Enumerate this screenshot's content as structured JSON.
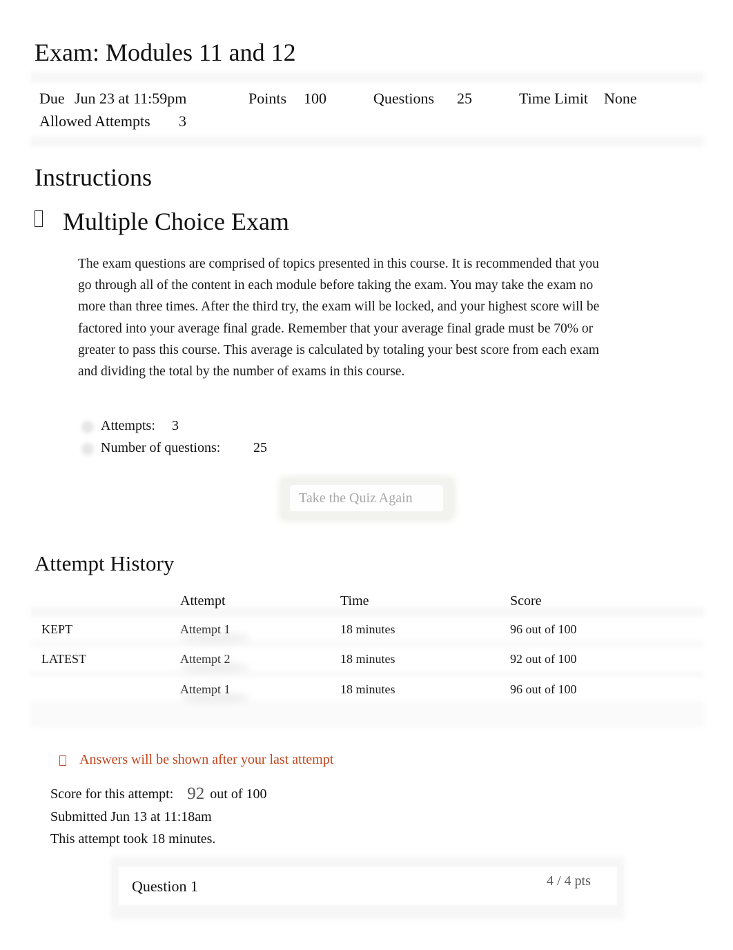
{
  "page": {
    "title": "Exam: Modules 11 and 12"
  },
  "meta": {
    "due_label": "Due",
    "due_value": "Jun 23 at 11:59pm",
    "points_label": "Points",
    "points_value": "100",
    "questions_label": "Questions",
    "questions_value": "25",
    "time_limit_label": "Time Limit",
    "time_limit_value": "None",
    "allowed_attempts_label": "Allowed Attempts",
    "allowed_attempts_value": "3"
  },
  "instructions": {
    "heading": "Instructions",
    "icon": "document-icon",
    "icon_glyph": "▯",
    "subheading": "Multiple Choice Exam",
    "paragraph": "The exam questions are comprised of topics presented in this course. It is recommended that you go through all of the content in each module before taking the exam. You may take the exam no more than three times. After the third try, the exam will be locked, and your highest score will be factored into your average final grade. Remember that your average final grade must be 70% or greater to pass this course. This average is calculated by totaling your best score from each exam and dividing the total by the number of exams in this course.",
    "details": [
      {
        "label": "Attempts:",
        "value": "3"
      },
      {
        "label": "Number of questions:",
        "value": "25"
      }
    ]
  },
  "actions": {
    "take_quiz_again": "Take the Quiz Again"
  },
  "attempt_history": {
    "heading": "Attempt History",
    "columns": [
      "",
      "Attempt",
      "Time",
      "Score"
    ],
    "rows": [
      {
        "tag": "KEPT",
        "attempt": "Attempt 1",
        "time": "18 minutes",
        "score": "96 out of 100"
      },
      {
        "tag": "LATEST",
        "attempt": "Attempt 2",
        "time": "18 minutes",
        "score": "92 out of 100"
      },
      {
        "tag": "",
        "attempt": "Attempt 1",
        "time": "18 minutes",
        "score": "96 out of 100"
      }
    ]
  },
  "result": {
    "warning_icon": "warning-icon",
    "warning": "Answers will be shown after your last attempt",
    "warning_color": "#c1441d",
    "score_label": "Score for this attempt:",
    "score_value": "92",
    "score_suffix": "out of 100",
    "submitted": "Submitted Jun 13 at 11:18am",
    "duration": "This attempt took 18 minutes."
  },
  "question": {
    "title": "Question 1",
    "points": "4 / 4 pts"
  }
}
